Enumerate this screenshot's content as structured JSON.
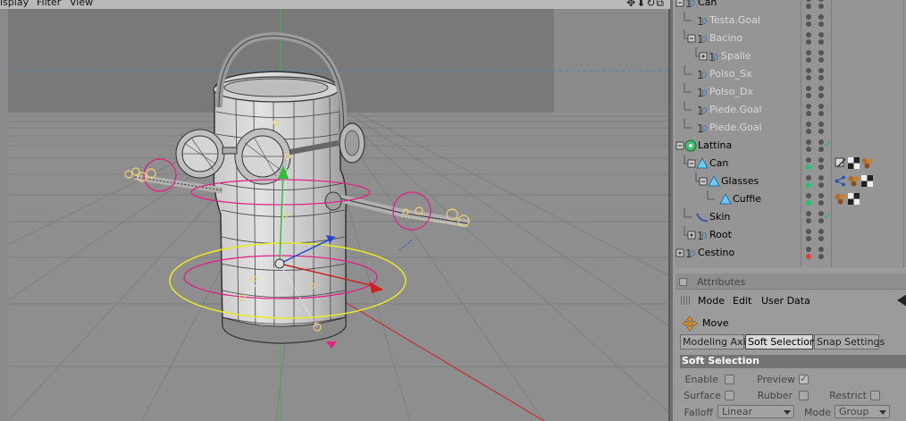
{
  "viewport": {
    "menu": [
      "isplay",
      "Filter",
      "View"
    ],
    "nav_icons": "✥⬇↻⧉"
  },
  "object_manager": {
    "rows": [
      {
        "name": "Can",
        "dim": false,
        "dots": [
          "#555",
          "#555"
        ],
        "tags": []
      },
      {
        "name": "Testa.Goal",
        "dim": true,
        "dots": [
          "#555",
          "#555"
        ],
        "tags": []
      },
      {
        "name": "Bacino",
        "dim": true,
        "dots": [
          "#555",
          "#555"
        ],
        "tags": []
      },
      {
        "name": "Spalle",
        "dim": true,
        "dots": [
          "#555",
          "#555"
        ],
        "tags": []
      },
      {
        "name": "Polso_Sx",
        "dim": true,
        "dots": [
          "#555",
          "#555"
        ],
        "tags": []
      },
      {
        "name": "Polso_Dx",
        "dim": true,
        "dots": [
          "#555",
          "#555"
        ],
        "tags": []
      },
      {
        "name": "Piede.Goal",
        "dim": true,
        "dots": [
          "#555",
          "#555"
        ],
        "tags": []
      },
      {
        "name": "Piede.Goal",
        "dim": true,
        "dots": [
          "#555",
          "#555"
        ],
        "tags": []
      },
      {
        "name": "Lattina",
        "dim": false,
        "dots": [
          "#555",
          "#555"
        ],
        "tags": [
          "check"
        ]
      },
      {
        "name": "Can",
        "dim": false,
        "dots": [
          "#555",
          "#1ec96e"
        ],
        "tags": [
          "rig-tag",
          "checker-material",
          "sphere-material"
        ]
      },
      {
        "name": "Glasses",
        "dim": false,
        "dots": [
          "#555",
          "#1ec96e"
        ],
        "tags": [
          "weight-tag",
          "sphere-material",
          "checker-material"
        ]
      },
      {
        "name": "Cuffie",
        "dim": false,
        "dots": [
          "#555",
          "#1ec96e"
        ],
        "tags": [
          "sphere-material",
          "checker-material"
        ]
      },
      {
        "name": "Skin",
        "dim": false,
        "dots": [
          "#555",
          "#555"
        ],
        "tags": [
          "check"
        ]
      },
      {
        "name": "Root",
        "dim": false,
        "dots": [
          "#555",
          "#555"
        ],
        "tags": []
      },
      {
        "name": "Cestino",
        "dim": false,
        "dots": [
          "#555",
          "#e63b3b"
        ],
        "tags": []
      }
    ]
  },
  "attributes": {
    "title": "Attributes",
    "menu": [
      "Mode",
      "Edit",
      "User Data"
    ],
    "tool_name": "Move",
    "tabs": [
      "Modeling Axis",
      "Soft Selection",
      "Snap Settings"
    ],
    "active_tab": "Soft Selection",
    "section": "Soft Selection",
    "fields": {
      "enable": "Enable",
      "preview": "Preview",
      "surface": "Surface",
      "rubber": "Rubber",
      "restrict": "Restrict",
      "falloff": "Falloff",
      "falloff_value": "Linear",
      "mode": "Mode",
      "mode_value": "Group"
    },
    "preview_checked": true
  }
}
